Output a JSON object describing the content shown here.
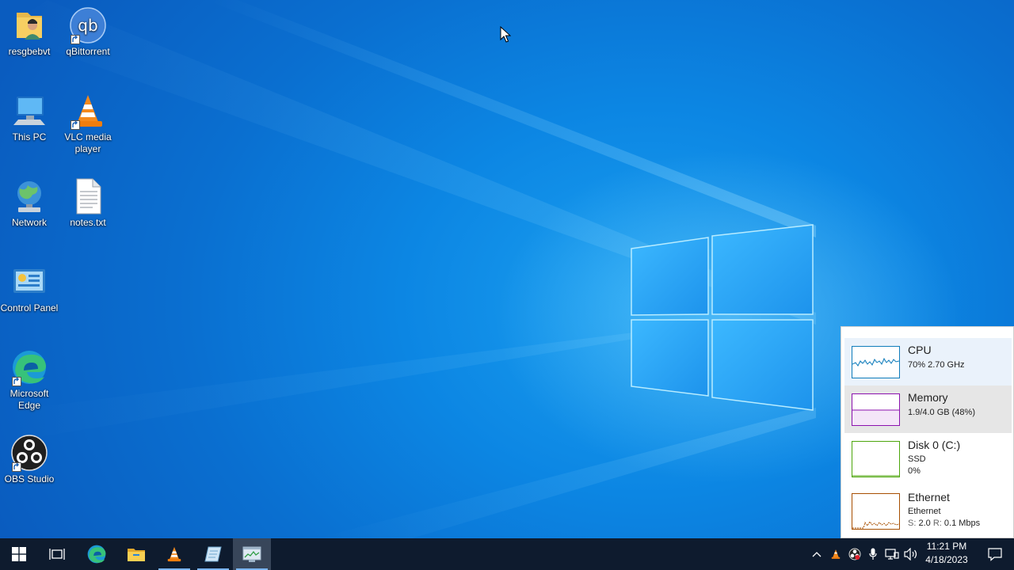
{
  "desktop": {
    "icons": [
      {
        "label": "resgbebvt",
        "icon": "user-folder-icon"
      },
      {
        "label": "qBittorrent",
        "icon": "qbittorrent-icon"
      },
      {
        "label": "This PC",
        "icon": "computer-icon"
      },
      {
        "label": "VLC media player",
        "icon": "vlc-icon"
      },
      {
        "label": "Network",
        "icon": "network-icon"
      },
      {
        "label": "notes.txt",
        "icon": "text-file-icon"
      },
      {
        "label": "Control Panel",
        "icon": "control-panel-icon"
      },
      {
        "label": "Microsoft Edge",
        "icon": "edge-icon"
      },
      {
        "label": "OBS Studio",
        "icon": "obs-icon"
      }
    ]
  },
  "perf_widget": {
    "cpu": {
      "title": "CPU",
      "line1": "70%  2.70 GHz",
      "color": "#117dbb",
      "percent": 70
    },
    "memory": {
      "title": "Memory",
      "line1": "1.9/4.0 GB (48%)",
      "color": "#8b12ae",
      "percent": 48
    },
    "disk": {
      "title": "Disk 0 (C:)",
      "line1": "SSD",
      "line2": "0%",
      "color": "#4da60c",
      "percent": 0
    },
    "ethernet": {
      "title": "Ethernet",
      "line1": "Ethernet",
      "line2_label_s": "S:",
      "line2_value_s": "2.0",
      "line2_label_r": "R:",
      "line2_value_r": "0.1 Mbps",
      "color": "#a74f01"
    }
  },
  "taskbar": {
    "buttons": [
      {
        "icon": "windows-start-icon"
      },
      {
        "icon": "task-view-icon"
      },
      {
        "icon": "edge-icon"
      },
      {
        "icon": "file-explorer-icon"
      },
      {
        "icon": "vlc-icon"
      },
      {
        "icon": "notepad-icon"
      },
      {
        "icon": "task-manager-icon",
        "active": true
      }
    ],
    "tray": [
      {
        "icon": "chevron-up-icon"
      },
      {
        "icon": "vlc-tray-icon"
      },
      {
        "icon": "obs-tray-icon"
      },
      {
        "icon": "microphone-icon"
      },
      {
        "icon": "network-wired-icon"
      },
      {
        "icon": "volume-icon"
      }
    ],
    "clock": {
      "time": "11:21 PM",
      "date": "4/18/2023"
    }
  }
}
